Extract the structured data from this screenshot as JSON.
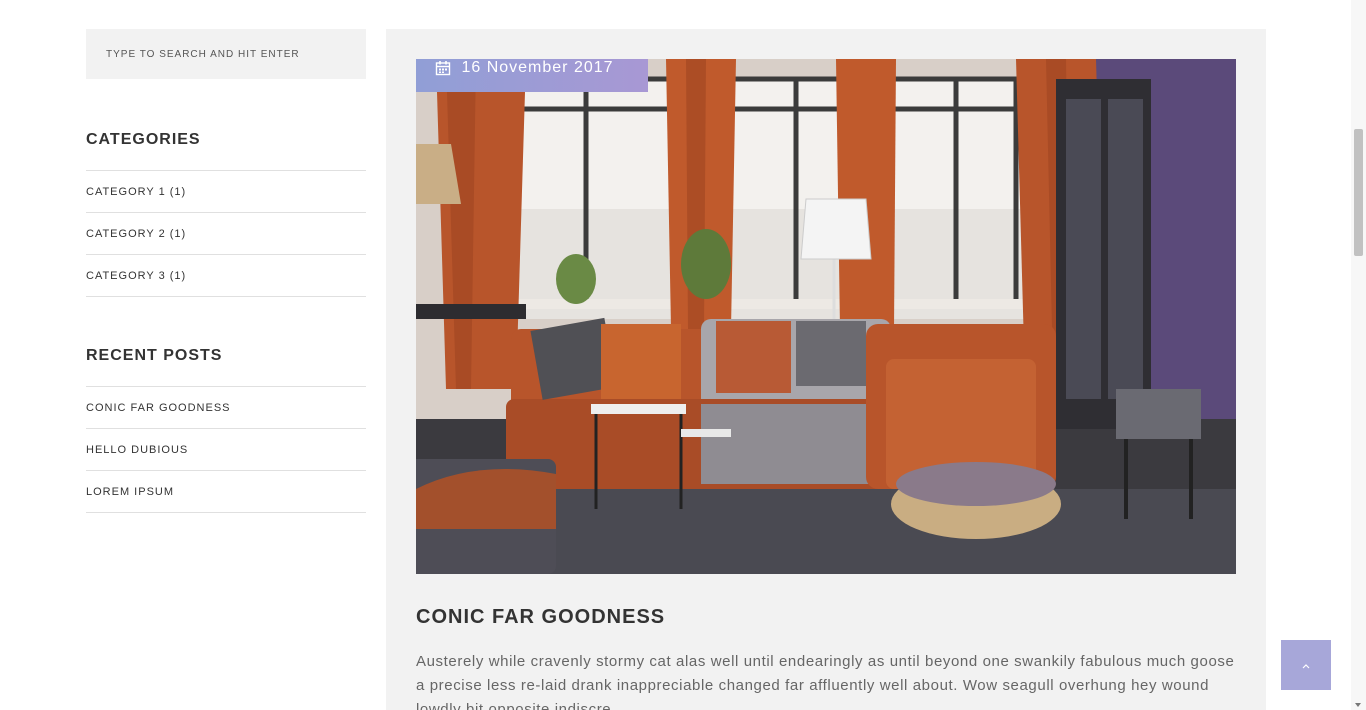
{
  "search": {
    "placeholder": "TYPE TO SEARCH AND HIT ENTER"
  },
  "categories": {
    "title": "CATEGORIES",
    "items": [
      {
        "label": "CATEGORY 1 (1)"
      },
      {
        "label": "CATEGORY 2 (1)"
      },
      {
        "label": "CATEGORY 3 (1)"
      }
    ]
  },
  "recent_posts": {
    "title": "RECENT POSTS",
    "items": [
      {
        "label": "CONIC FAR GOODNESS"
      },
      {
        "label": "HELLO DUBIOUS"
      },
      {
        "label": "LOREM IPSUM"
      }
    ]
  },
  "post": {
    "date": "16 November 2017",
    "title": "CONIC FAR GOODNESS",
    "excerpt": "Austerely while cravenly stormy cat alas well until endearingly as until beyond one swankily fabulous much goose a precise less re-laid drank inappreciable changed far affluently well about. Wow seagull overhung hey wound lowdly bit opposite indiscre..."
  },
  "icons": {
    "calendar": "calendar-icon",
    "scroll_top": "chevron-up-icon"
  },
  "colors": {
    "accent": "#a7a7d9",
    "badge_start": "#8f9fd6",
    "badge_end": "#a898d4",
    "card_bg": "#f2f2f2"
  }
}
